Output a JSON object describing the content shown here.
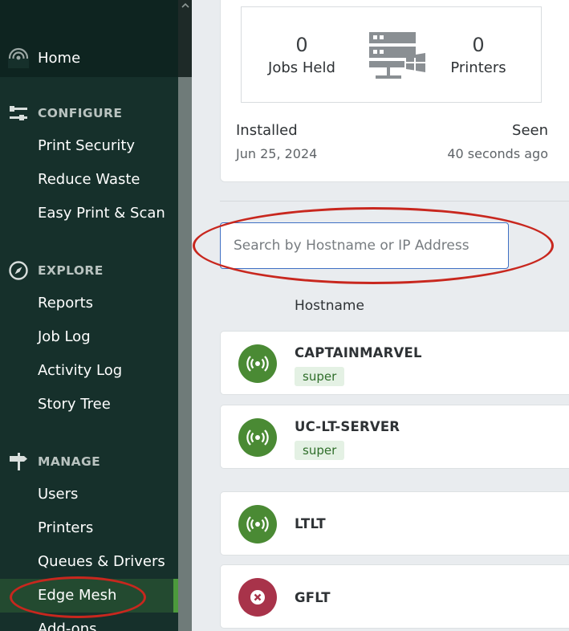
{
  "sidebar": {
    "home_label": "Home",
    "sections": [
      {
        "label": "CONFIGURE",
        "icon": "sliders-icon",
        "items": [
          "Print Security",
          "Reduce Waste",
          "Easy Print & Scan"
        ]
      },
      {
        "label": "EXPLORE",
        "icon": "compass-icon",
        "items": [
          "Reports",
          "Job Log",
          "Activity Log",
          "Story Tree"
        ]
      },
      {
        "label": "MANAGE",
        "icon": "signpost-icon",
        "items": [
          "Users",
          "Printers",
          "Queues & Drivers",
          "Edge Mesh",
          "Add-ons"
        ]
      }
    ],
    "active_item": "Edge Mesh"
  },
  "server_card": {
    "jobs_held_value": "0",
    "jobs_held_label": "Jobs Held",
    "printers_value": "0",
    "printers_label": "Printers",
    "installed_label": "Installed",
    "installed_value": "Jun 25, 2024",
    "seen_label": "Seen",
    "seen_value": "40 seconds ago"
  },
  "search": {
    "placeholder": "Search by Hostname or IP Address",
    "value": ""
  },
  "table": {
    "column_header": "Hostname",
    "rows": [
      {
        "hostname": "CAPTAINMARVEL",
        "tag": "super",
        "status": "online"
      },
      {
        "hostname": "UC-LT-SERVER",
        "tag": "super",
        "status": "online"
      },
      {
        "hostname": "LTLT",
        "tag": "",
        "status": "online"
      },
      {
        "hostname": "GFLT",
        "tag": "",
        "status": "error"
      }
    ]
  },
  "colors": {
    "sidebar_bg": "#16302b",
    "online_green": "#4a8a34",
    "error_red": "#a8334a",
    "annotation_red": "#c8271e",
    "active_accent": "#4c9a3c"
  }
}
